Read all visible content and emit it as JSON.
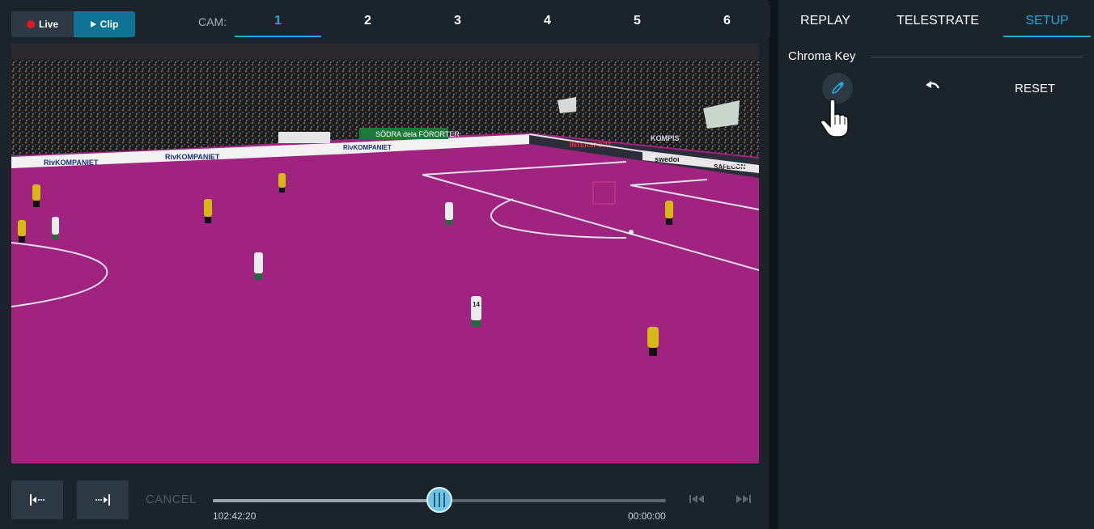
{
  "mode": {
    "live_label": "Live",
    "clip_label": "Clip"
  },
  "cameras": {
    "label": "CAM:",
    "tabs": [
      "1",
      "2",
      "3",
      "4",
      "5",
      "6"
    ],
    "active": "1"
  },
  "video": {
    "banner_text": "RivKOMPANIET",
    "ads": [
      "SÖDRA dela FÖRORTER",
      "INTERSPORT",
      "swedol",
      "SAFECON",
      "KOMPIS"
    ],
    "player_number": "14"
  },
  "controls": {
    "cancel_label": "CANCEL",
    "time_start": "102:42:20",
    "time_end": "00:00:00",
    "scrub_fraction": 0.5
  },
  "right_tabs": [
    "REPLAY",
    "TELESTRATE",
    "SETUP"
  ],
  "active_right_tab": "SETUP",
  "chroma": {
    "title": "Chroma Key",
    "reset_label": "RESET",
    "picker_icon": "eyedropper-icon",
    "undo_icon": "undo-icon"
  },
  "colors": {
    "accent": "#1fa8d8",
    "clip": "#0f7396",
    "live_dot": "#e8151f",
    "key_overlay": "#a0237f"
  }
}
